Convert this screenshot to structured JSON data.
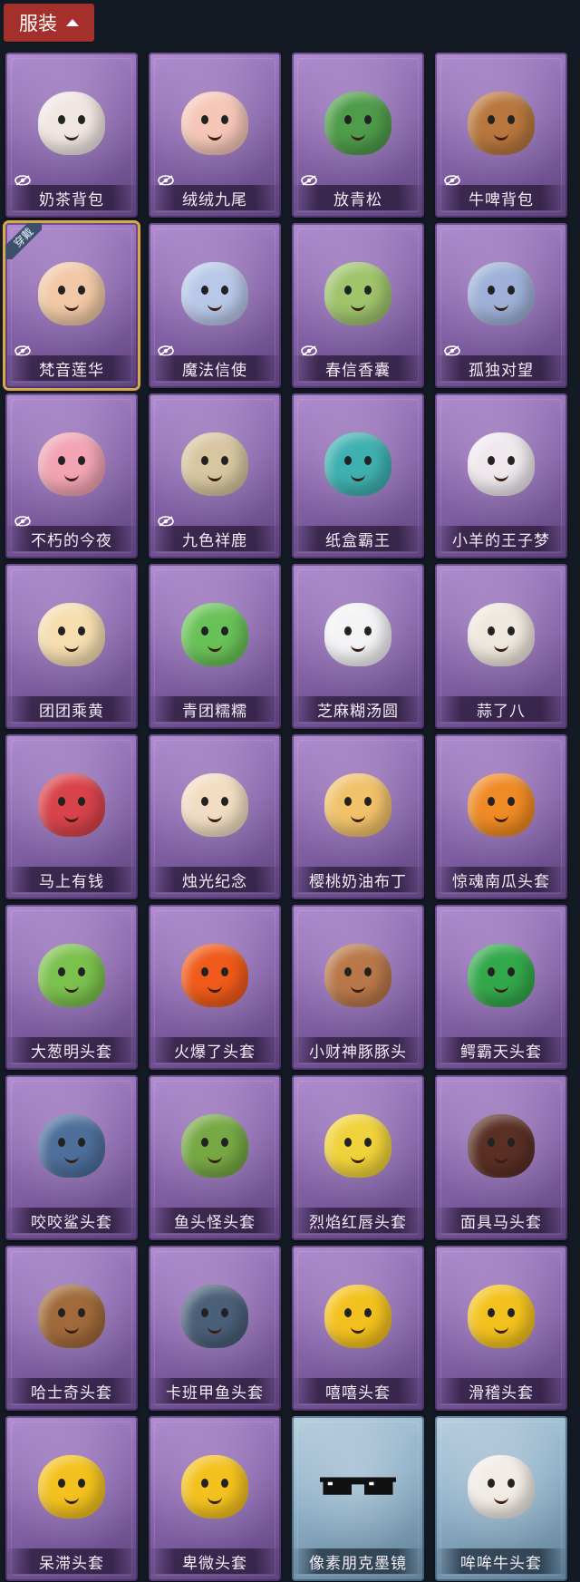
{
  "header": {
    "label": "服装"
  },
  "items": [
    {
      "name": "奶茶背包",
      "art": "bag",
      "color": "#f1e7e2",
      "hidden": true,
      "theme": "purple"
    },
    {
      "name": "绒绒九尾",
      "art": "fox",
      "color": "#f6c7b8",
      "hidden": true,
      "theme": "purple"
    },
    {
      "name": "放青松",
      "art": "tree",
      "color": "#4f9c4a",
      "hidden": true,
      "theme": "purple"
    },
    {
      "name": "牛啤背包",
      "art": "barrel",
      "color": "#b8773e",
      "hidden": true,
      "theme": "purple"
    },
    {
      "name": "梵音莲华",
      "art": "doll",
      "color": "#f2c9a6",
      "hidden": true,
      "theme": "purple",
      "equipped": true,
      "badge": "穿戴"
    },
    {
      "name": "魔法信使",
      "art": "elephant",
      "color": "#b9c8e8",
      "hidden": true,
      "theme": "purple"
    },
    {
      "name": "春信香囊",
      "art": "sachet",
      "color": "#9fc46c",
      "hidden": true,
      "theme": "purple"
    },
    {
      "name": "孤独对望",
      "art": "charm",
      "color": "#9fb1d8",
      "hidden": true,
      "theme": "purple"
    },
    {
      "name": "不朽的今夜",
      "art": "bowl",
      "color": "#f2a4b4",
      "hidden": true,
      "theme": "purple"
    },
    {
      "name": "九色祥鹿",
      "art": "deer",
      "color": "#d7c6a0",
      "hidden": true,
      "theme": "purple"
    },
    {
      "name": "纸盒霸王",
      "art": "dino",
      "color": "#3fb0b0",
      "hidden": false,
      "theme": "purple"
    },
    {
      "name": "小羊的王子梦",
      "art": "sheep",
      "color": "#efe9ee",
      "hidden": false,
      "theme": "purple"
    },
    {
      "name": "团团乘黄",
      "art": "blob",
      "color": "#f6deb0",
      "hidden": false,
      "theme": "purple"
    },
    {
      "name": "青团糯糯",
      "art": "blob",
      "color": "#69c257",
      "hidden": false,
      "theme": "purple"
    },
    {
      "name": "芝麻糊汤圆",
      "art": "blob",
      "color": "#f4f4f6",
      "hidden": false,
      "theme": "purple"
    },
    {
      "name": "蒜了八",
      "art": "blob",
      "color": "#efe8de",
      "hidden": false,
      "theme": "purple"
    },
    {
      "name": "马上有钱",
      "art": "blob",
      "color": "#d9434b",
      "hidden": false,
      "theme": "purple"
    },
    {
      "name": "烛光纪念",
      "art": "blob",
      "color": "#f2ddc2",
      "hidden": false,
      "theme": "purple"
    },
    {
      "name": "樱桃奶油布丁",
      "art": "blob",
      "color": "#f1c26a",
      "hidden": false,
      "theme": "purple"
    },
    {
      "name": "惊魂南瓜头套",
      "art": "blob",
      "color": "#f08a24",
      "hidden": false,
      "theme": "purple"
    },
    {
      "name": "大葱明头套",
      "art": "blob",
      "color": "#7cc14e",
      "hidden": false,
      "theme": "purple"
    },
    {
      "name": "火爆了头套",
      "art": "blob",
      "color": "#f05a1a",
      "hidden": false,
      "theme": "purple"
    },
    {
      "name": "小财神豚豚头",
      "art": "blob",
      "color": "#b9784a",
      "hidden": false,
      "theme": "purple"
    },
    {
      "name": "鳄霸天头套",
      "art": "blob",
      "color": "#33a84a",
      "hidden": false,
      "theme": "purple"
    },
    {
      "name": "咬咬鲨头套",
      "art": "blob",
      "color": "#4d6f9a",
      "hidden": false,
      "theme": "purple"
    },
    {
      "name": "鱼头怪头套",
      "art": "blob",
      "color": "#76a843",
      "hidden": false,
      "theme": "purple"
    },
    {
      "name": "烈焰红唇头套",
      "art": "blob",
      "color": "#f0d23a",
      "hidden": false,
      "theme": "purple"
    },
    {
      "name": "面具马头套",
      "art": "blob",
      "color": "#5a2f24",
      "hidden": false,
      "theme": "purple"
    },
    {
      "name": "哈士奇头套",
      "art": "blob",
      "color": "#a06a3a",
      "hidden": false,
      "theme": "purple"
    },
    {
      "name": "卡班甲鱼头套",
      "art": "blob",
      "color": "#4a5f78",
      "hidden": false,
      "theme": "purple"
    },
    {
      "name": "嘻嘻头套",
      "art": "blob",
      "color": "#f4c21e",
      "hidden": false,
      "theme": "purple"
    },
    {
      "name": "滑稽头套",
      "art": "blob",
      "color": "#f4c21e",
      "hidden": false,
      "theme": "purple"
    },
    {
      "name": "呆滞头套",
      "art": "blob",
      "color": "#f4c21e",
      "hidden": false,
      "theme": "purple"
    },
    {
      "name": "卑微头套",
      "art": "blob",
      "color": "#f4c21e",
      "hidden": false,
      "theme": "purple"
    },
    {
      "name": "像素朋克墨镜",
      "art": "glasses",
      "color": "#111111",
      "hidden": false,
      "theme": "blue"
    },
    {
      "name": "哞哞牛头套",
      "art": "blob",
      "color": "#f2ece6",
      "hidden": false,
      "theme": "blue"
    }
  ]
}
